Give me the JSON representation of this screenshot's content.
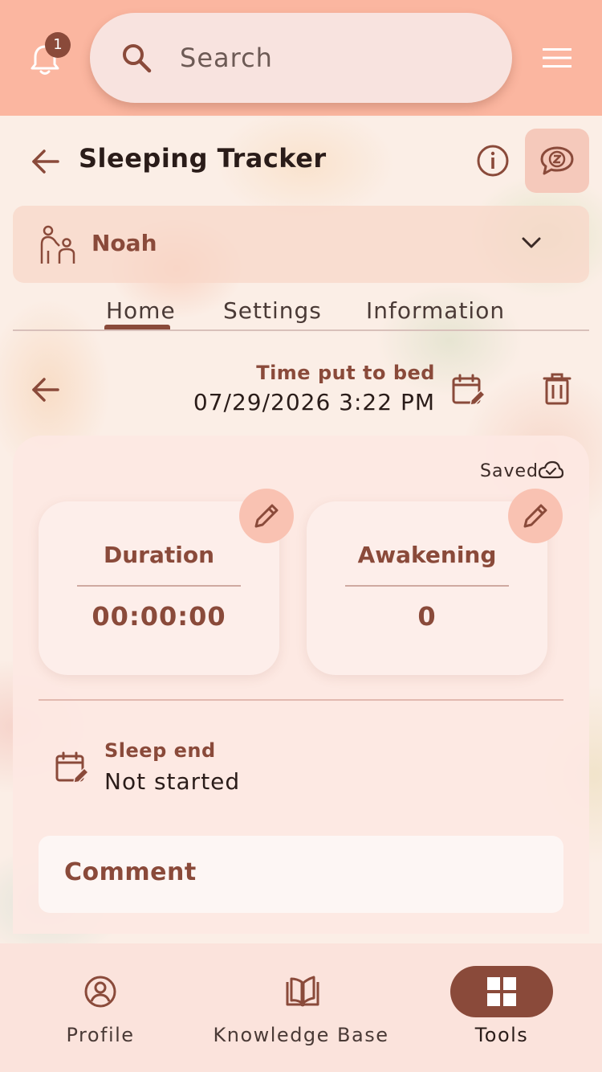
{
  "header": {
    "notification_count": "1",
    "search_placeholder": "Search"
  },
  "page": {
    "title": "Sleeping Tracker"
  },
  "child_selector": {
    "name": "Noah"
  },
  "tabs": [
    {
      "label": "Home",
      "active": true
    },
    {
      "label": "Settings",
      "active": false
    },
    {
      "label": "Information",
      "active": false
    }
  ],
  "entry": {
    "time_label": "Time put to bed",
    "time_value": "07/29/2026 3:22 PM"
  },
  "card": {
    "status": "Saved",
    "duration_label": "Duration",
    "duration_value": "00:00:00",
    "awakening_label": "Awakening",
    "awakening_value": "0",
    "sleep_end_label": "Sleep end",
    "sleep_end_value": "Not started",
    "comment_label": "Comment"
  },
  "bottom_nav": [
    {
      "label": "Profile",
      "icon": "profile-icon",
      "active": false
    },
    {
      "label": "Knowledge Base",
      "icon": "book-icon",
      "active": false
    },
    {
      "label": "Tools",
      "icon": "grid-icon",
      "active": true
    }
  ],
  "colors": {
    "header_bg": "#fbb6a0",
    "accent": "#8a4a3a",
    "card_bg": "#fde8e3",
    "nav_bg": "#fbe3dc"
  }
}
